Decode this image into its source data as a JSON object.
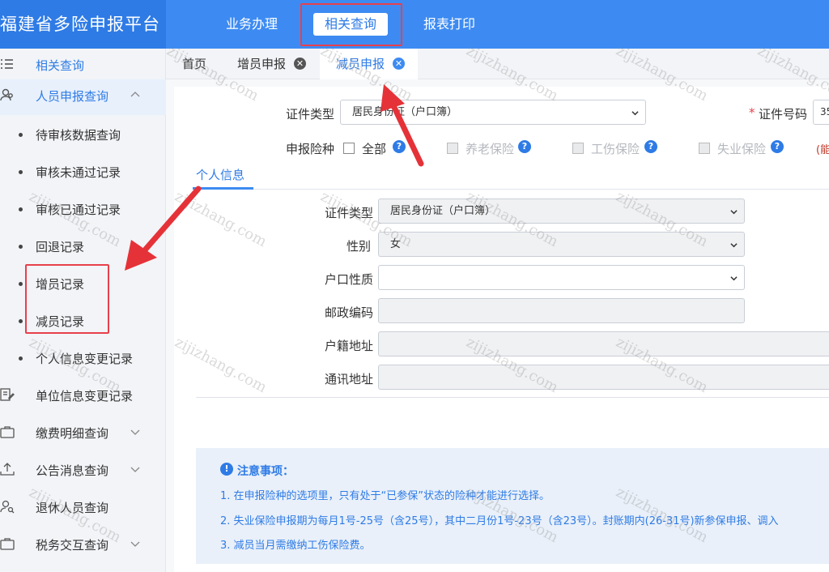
{
  "header": {
    "logo": "福建省多险申报平台",
    "nav": [
      "业务办理",
      "相关查询",
      "报表打印"
    ],
    "active_nav": "相关查询"
  },
  "sidebar": {
    "top_item": "相关查询",
    "group": "人员申报查询",
    "sub_items": [
      "待审核数据查询",
      "审核未通过记录",
      "审核已通过记录",
      "回退记录",
      "增员记录",
      "减员记录",
      "个人信息变更记录"
    ],
    "sections": [
      "单位信息变更记录",
      "缴费明细查询",
      "公告消息查询",
      "退休人员查询",
      "税务交互查询"
    ]
  },
  "tabs": [
    "首页",
    "增员申报",
    "减员申报"
  ],
  "active_tab": "减员申报",
  "filters": {
    "id_type_label": "证件类型",
    "id_type_value": "居民身份证（户口簿）",
    "id_number_label": "证件号码",
    "id_number_required": "*",
    "id_number_partial": "35",
    "insurance_label": "申报险种",
    "insurance_options": [
      "全部",
      "养老保险",
      "工伤保险",
      "失业保险"
    ],
    "red_note": "(能"
  },
  "personal": {
    "section_title": "个人信息",
    "fields": {
      "id_type_label": "证件类型",
      "id_type_value": "居民身份证（户口簿）",
      "gender_label": "性别",
      "gender_value": "女",
      "hukou_label": "户口性质",
      "postcode_label": "邮政编码",
      "address_label": "户籍地址",
      "mail_label": "通讯地址"
    }
  },
  "notice": {
    "title": "注意事项：",
    "lines": [
      "1. 在申报险种的选项里，只有处于“已参保”状态的险种才能进行选择。",
      "2. 失业保险申报期为每月1号-25号（含25号），其中二月份1号-23号（含23号）。封账期内(26-31号)新参保申报、调入",
      "3. 减员当月需缴纳工伤保险费。"
    ]
  },
  "watermark": "zijizhang.com",
  "colors": {
    "brand": "#3d8bf2",
    "highlight": "#e8404b",
    "arrow": "#e53238"
  }
}
